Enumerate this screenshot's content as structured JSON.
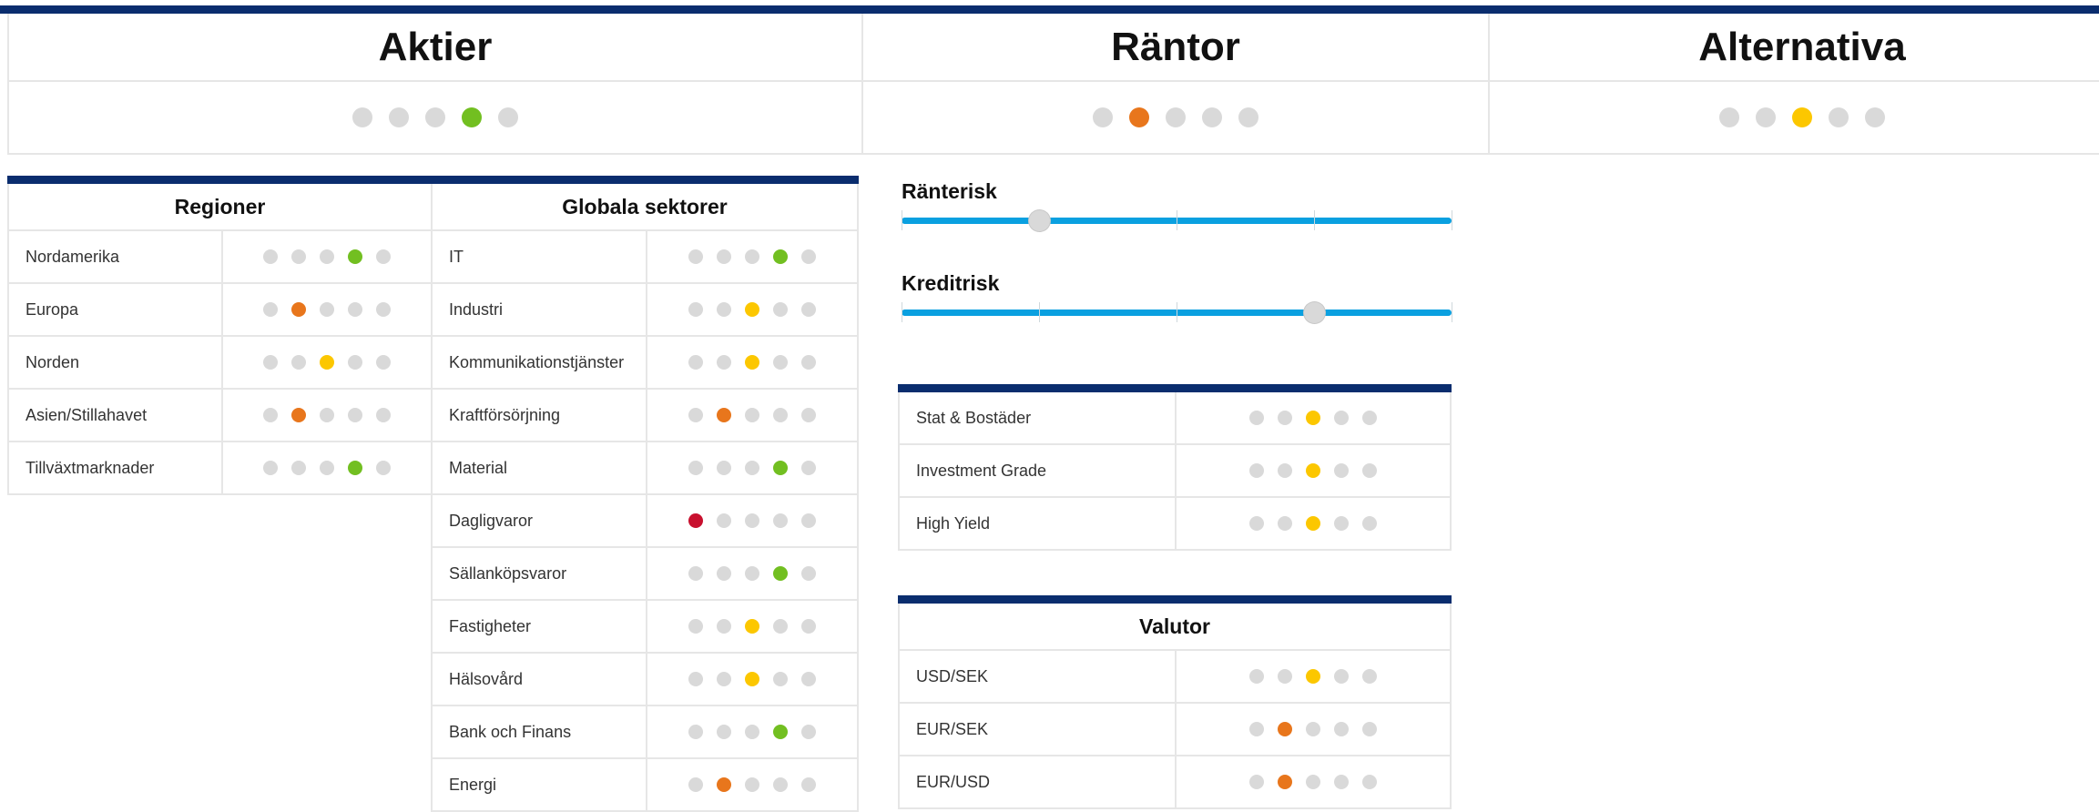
{
  "top": [
    {
      "title": "Aktier",
      "level": 4,
      "color": "green"
    },
    {
      "title": "Räntor",
      "level": 2,
      "color": "orange"
    },
    {
      "title": "Alternativa",
      "level": 3,
      "color": "yellow"
    }
  ],
  "regions": {
    "title": "Regioner",
    "rows": [
      {
        "label": "Nordamerika",
        "level": 4,
        "color": "green"
      },
      {
        "label": "Europa",
        "level": 2,
        "color": "orange"
      },
      {
        "label": "Norden",
        "level": 3,
        "color": "yellow"
      },
      {
        "label": "Asien/Stillahavet",
        "level": 2,
        "color": "orange"
      },
      {
        "label": "Tillväxtmarknader",
        "level": 4,
        "color": "green"
      }
    ]
  },
  "sectors": {
    "title": "Globala sektorer",
    "rows": [
      {
        "label": "IT",
        "level": 4,
        "color": "green"
      },
      {
        "label": "Industri",
        "level": 3,
        "color": "yellow"
      },
      {
        "label": "Kommunikationstjänster",
        "level": 3,
        "color": "yellow"
      },
      {
        "label": "Kraftförsörjning",
        "level": 2,
        "color": "orange"
      },
      {
        "label": "Material",
        "level": 4,
        "color": "green"
      },
      {
        "label": "Dagligvaror",
        "level": 1,
        "color": "red"
      },
      {
        "label": "Sällanköpsvaror",
        "level": 4,
        "color": "green"
      },
      {
        "label": "Fastigheter",
        "level": 3,
        "color": "yellow"
      },
      {
        "label": "Hälsovård",
        "level": 3,
        "color": "yellow"
      },
      {
        "label": "Bank och Finans",
        "level": 4,
        "color": "green"
      },
      {
        "label": "Energi",
        "level": 2,
        "color": "orange"
      }
    ]
  },
  "sliders": [
    {
      "label": "Ränterisk",
      "value": 0.25
    },
    {
      "label": "Kreditrisk",
      "value": 0.75
    }
  ],
  "rates": {
    "rows": [
      {
        "label": "Stat & Bostäder",
        "level": 3,
        "color": "yellow"
      },
      {
        "label": "Investment Grade",
        "level": 3,
        "color": "yellow"
      },
      {
        "label": "High Yield",
        "level": 3,
        "color": "yellow"
      }
    ]
  },
  "currencies": {
    "title": "Valutor",
    "rows": [
      {
        "label": "USD/SEK",
        "level": 3,
        "color": "yellow"
      },
      {
        "label": "EUR/SEK",
        "level": 2,
        "color": "orange"
      },
      {
        "label": "EUR/USD",
        "level": 2,
        "color": "orange"
      }
    ]
  }
}
